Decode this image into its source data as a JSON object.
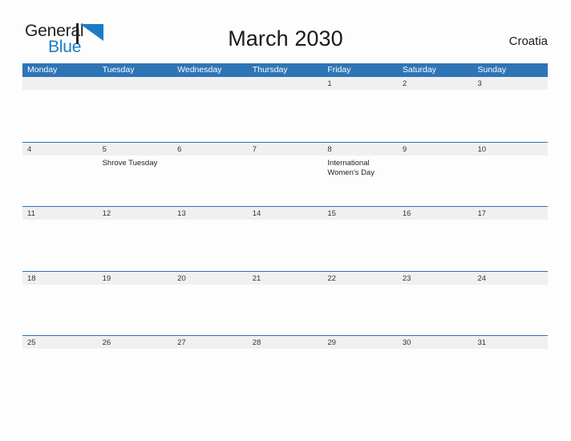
{
  "brand": {
    "line1": "General",
    "line2": "Blue",
    "mark_color": "#1b7cc4",
    "text_color": "#231f20",
    "accent_color": "#1b7cc4"
  },
  "header": {
    "title": "March 2030",
    "locale": "Croatia"
  },
  "theme": {
    "header_blue": "#2e75b6",
    "band_gray": "#f0f0f0",
    "page_background": "#fdfdfd",
    "rule_blue": "#2e75b6"
  },
  "calendar": {
    "month": "March",
    "year": 2030,
    "weekday_headers": [
      "Monday",
      "Tuesday",
      "Wednesday",
      "Thursday",
      "Friday",
      "Saturday",
      "Sunday"
    ],
    "weeks": [
      [
        {
          "date": "",
          "events": []
        },
        {
          "date": "",
          "events": []
        },
        {
          "date": "",
          "events": []
        },
        {
          "date": "",
          "events": []
        },
        {
          "date": "1",
          "events": []
        },
        {
          "date": "2",
          "events": []
        },
        {
          "date": "3",
          "events": []
        }
      ],
      [
        {
          "date": "4",
          "events": []
        },
        {
          "date": "5",
          "events": [
            "Shrove Tuesday"
          ]
        },
        {
          "date": "6",
          "events": []
        },
        {
          "date": "7",
          "events": []
        },
        {
          "date": "8",
          "events": [
            "International Women's Day"
          ]
        },
        {
          "date": "9",
          "events": []
        },
        {
          "date": "10",
          "events": []
        }
      ],
      [
        {
          "date": "11",
          "events": []
        },
        {
          "date": "12",
          "events": []
        },
        {
          "date": "13",
          "events": []
        },
        {
          "date": "14",
          "events": []
        },
        {
          "date": "15",
          "events": []
        },
        {
          "date": "16",
          "events": []
        },
        {
          "date": "17",
          "events": []
        }
      ],
      [
        {
          "date": "18",
          "events": []
        },
        {
          "date": "19",
          "events": []
        },
        {
          "date": "20",
          "events": []
        },
        {
          "date": "21",
          "events": []
        },
        {
          "date": "22",
          "events": []
        },
        {
          "date": "23",
          "events": []
        },
        {
          "date": "24",
          "events": []
        }
      ],
      [
        {
          "date": "25",
          "events": []
        },
        {
          "date": "26",
          "events": []
        },
        {
          "date": "27",
          "events": []
        },
        {
          "date": "28",
          "events": []
        },
        {
          "date": "29",
          "events": []
        },
        {
          "date": "30",
          "events": []
        },
        {
          "date": "31",
          "events": []
        }
      ]
    ]
  }
}
